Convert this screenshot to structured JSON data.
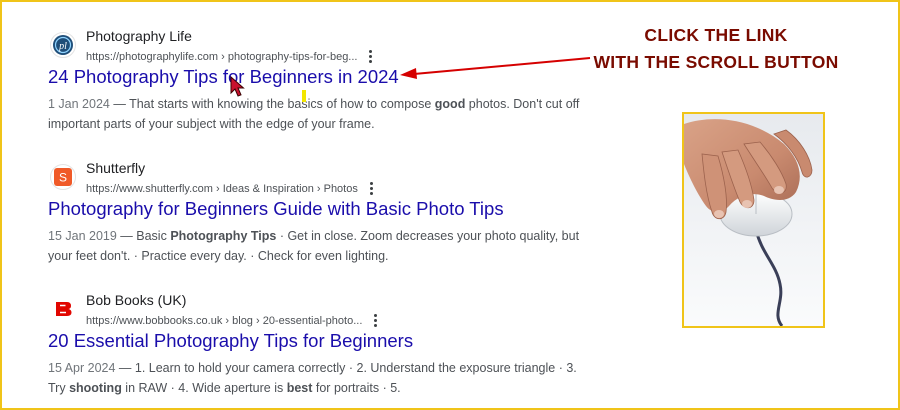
{
  "results": [
    {
      "site_name": "Photography Life",
      "url": "https://photographylife.com › photography-tips-for-beg...",
      "title": "24 Photography Tips for Beginners in 2024",
      "date": "1 Jan 2024",
      "snippet_a": " — That starts with knowing the basics of how to compose ",
      "snippet_bold": "good",
      "snippet_b": " photos. Don't cut off important parts of your subject with the edge of your frame."
    },
    {
      "site_name": "Shutterfly",
      "url": "https://www.shutterfly.com › Ideas & Inspiration › Photos",
      "title": "Photography for Beginners Guide with Basic Photo Tips",
      "date": "15 Jan 2019",
      "snippet_a": " — Basic ",
      "snippet_bold": "Photography Tips",
      "snippet_b": " · Get in close. Zoom decreases your photo quality, but your feet don't. · Practice every day. · Check for even lighting."
    },
    {
      "site_name": "Bob Books (UK)",
      "url": "https://www.bobbooks.co.uk › blog › 20-essential-photo...",
      "title": "20 Essential Photography Tips for Beginners",
      "date": "15 Apr 2024",
      "snippet_a": " — 1. Learn to hold your camera correctly · 2. Understand the exposure triangle · 3. Try ",
      "snippet_bold": "shooting",
      "snippet_b": " in RAW · 4. Wide aperture is ",
      "snippet_bold2": "best",
      "snippet_c": " for portraits · 5."
    }
  ],
  "callout": {
    "line1": "CLICK THE LINK",
    "line2": "WITH THE SCROLL BUTTON"
  },
  "colors": {
    "link": "#1a0dab",
    "border": "#f0c419",
    "callout": "#7a0b00",
    "arrow": "#d50000"
  }
}
